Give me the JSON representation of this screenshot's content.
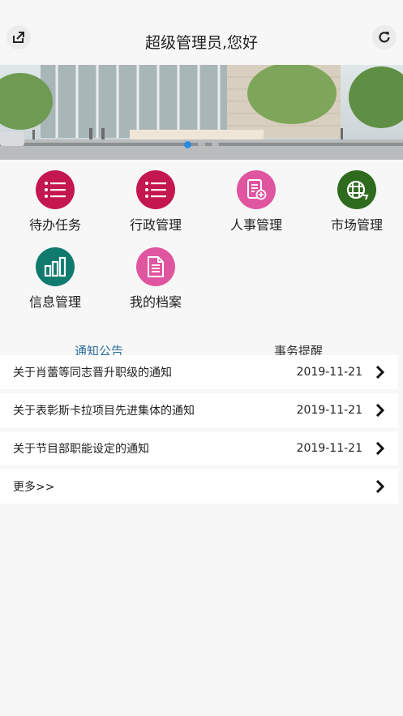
{
  "header": {
    "title": "超级管理员,您好",
    "left_icon": "share-icon",
    "right_icon": "refresh-icon"
  },
  "banner": {
    "slides": 3,
    "active_slide": 1
  },
  "menu": [
    {
      "label": "待办任务",
      "color": "#c4174f",
      "icon": "list-icon"
    },
    {
      "label": "行政管理",
      "color": "#c4174f",
      "icon": "list-icon"
    },
    {
      "label": "人事管理",
      "color": "#e055a0",
      "icon": "document-add-icon"
    },
    {
      "label": "市场管理",
      "color": "#2e6b1e",
      "icon": "globe-icon"
    },
    {
      "label": "信息管理",
      "color": "#0f7a6e",
      "icon": "bar-chart-icon"
    },
    {
      "label": "我的档案",
      "color": "#e055a0",
      "icon": "document-icon"
    }
  ],
  "tabs": [
    {
      "label": "通知公告",
      "active": true
    },
    {
      "label": "事务提醒",
      "active": false
    }
  ],
  "notices": [
    {
      "title": "关于肖蕾等同志晋升职级的通知",
      "date": "2019-11-21"
    },
    {
      "title": "关于表彰斯卡拉项目先进集体的通知",
      "date": "2019-11-21"
    },
    {
      "title": "关于节目部职能设定的通知",
      "date": "2019-11-21"
    }
  ],
  "more_label": "更多>>"
}
